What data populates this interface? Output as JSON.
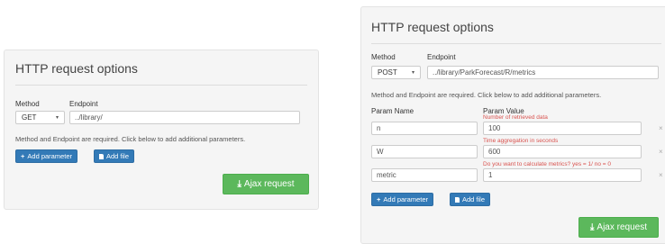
{
  "left": {
    "title": "HTTP request options",
    "method_label": "Method",
    "endpoint_label": "Endpoint",
    "method_value": "GET",
    "endpoint_value": "../library/",
    "help_text": "Method and Endpoint are required. Click below to add additional parameters.",
    "add_parameter_label": "Add parameter",
    "add_file_label": "Add file",
    "ajax_label": "Ajax request"
  },
  "right": {
    "title": "HTTP request options",
    "method_label": "Method",
    "endpoint_label": "Endpoint",
    "method_value": "POST",
    "endpoint_value": "../library/ParkForecast/R/metrics",
    "help_text": "Method and Endpoint are required. Click below to add additional parameters.",
    "param_name_header": "Param Name",
    "param_value_header": "Param Value",
    "params": [
      {
        "name": "n",
        "value": "100",
        "hint": "Number of retrieved data"
      },
      {
        "name": "W",
        "value": "600",
        "hint": "Time aggregation in seconds"
      },
      {
        "name": "metric",
        "value": "1",
        "hint": "Do you want to calculate metrics? yes = 1/  no = 0"
      }
    ],
    "add_parameter_label": "Add parameter",
    "add_file_label": "Add file",
    "ajax_label": "Ajax request"
  },
  "icons": {
    "caret": "▾",
    "plus": "+",
    "remove": "×",
    "download": "⤓"
  },
  "colors": {
    "primary": "#337ab7",
    "success": "#5cb85c",
    "hint": "#d9534f",
    "panel": "#f5f5f5"
  }
}
